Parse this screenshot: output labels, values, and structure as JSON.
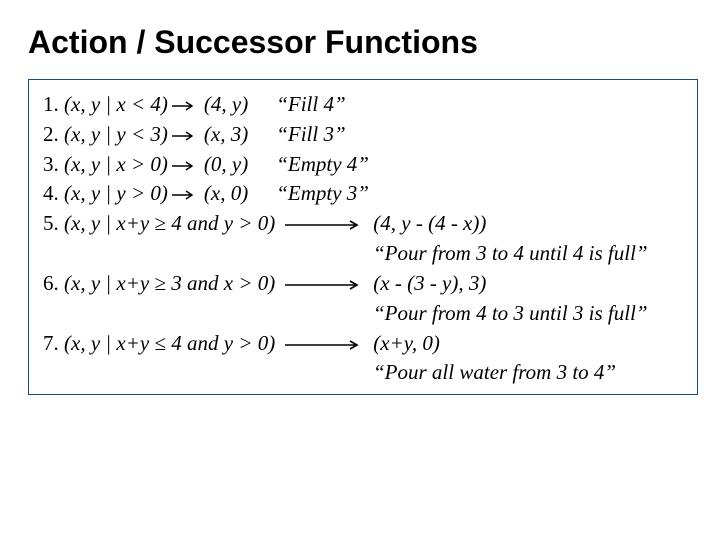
{
  "title": "Action / Successor Functions",
  "rows": {
    "r1": {
      "num": "1.",
      "pre": "(x, y | x < 4)",
      "post": "(4, y)",
      "label": "“Fill  4”"
    },
    "r2": {
      "num": "2.",
      "pre": "(x, y | y < 3)",
      "post": "(x, 3)",
      "label": "“Fill  3”"
    },
    "r3": {
      "num": "3.",
      "pre": "(x, y | x > 0)",
      "post": "(0, y)",
      "label": "“Empty 4”"
    },
    "r4": {
      "num": "4.",
      "pre": "(x, y | y > 0)",
      "post": "(x, 0)",
      "label": "“Empty 3”"
    },
    "r5": {
      "num": "5.",
      "pre_a": "(x, y | x+y ",
      "pre_b": "≥",
      "pre_c": " 4  and y > 0)",
      "post": "(4, y - (4 - x))",
      "label": "“Pour from 3 to 4 until 4 is full”"
    },
    "r6": {
      "num": "6.",
      "pre_a": "(x, y | x+y ",
      "pre_b": "≥",
      "pre_c": " 3  and x > 0)",
      "post": "(x - (3 - y), 3)",
      "label": "“Pour from 4 to 3 until 3 is full”"
    },
    "r7": {
      "num": "7.",
      "pre_a": "(x, y | x+y ",
      "pre_b": "≤",
      "pre_c": " 4  and y > 0)",
      "post": "(x+y, 0)",
      "label": "“Pour all water from 3 to 4”"
    }
  }
}
